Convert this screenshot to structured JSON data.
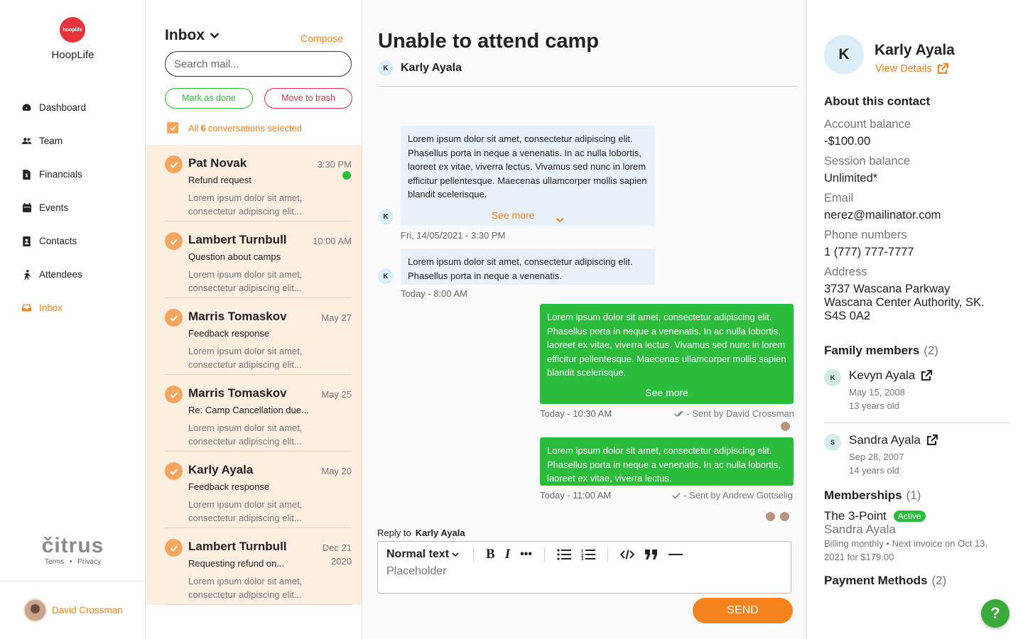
{
  "app": {
    "name": "HoopLife",
    "logo_text": "hooplife",
    "accent": "#f5841f",
    "success": "#2bbc3c",
    "danger": "#e33346"
  },
  "sidebar": {
    "items": [
      {
        "label": "Dashboard",
        "icon": "dashboard-icon"
      },
      {
        "label": "Team",
        "icon": "team-icon"
      },
      {
        "label": "Financials",
        "icon": "financials-icon"
      },
      {
        "label": "Events",
        "icon": "calendar-icon"
      },
      {
        "label": "Contacts",
        "icon": "contacts-icon"
      },
      {
        "label": "Attendees",
        "icon": "attendees-icon"
      },
      {
        "label": "Inbox",
        "icon": "inbox-icon",
        "active": true
      }
    ],
    "footer": {
      "brand": "čitrus",
      "terms": "Terms",
      "separator": "•",
      "privacy": "Privacy"
    },
    "user": {
      "name": "David Crossman"
    }
  },
  "inbox": {
    "title": "Inbox",
    "compose": "Compose",
    "search_placeholder": "Search mail...",
    "mark_done": "Mark as done",
    "move_trash": "Move to trash",
    "selection": {
      "prefix": "All",
      "count": "6",
      "suffix": "conversations selected"
    },
    "conversations": [
      {
        "name": "Pat Novak",
        "subject": "Refund request",
        "preview": "Lorem ipsum dolor sit amet, consectetur adipiscing elit...",
        "time": "3:30 PM",
        "unread": true
      },
      {
        "name": "Lambert Turnbull",
        "subject": "Question about camps",
        "preview": "Lorem ipsum dolor sit amet, consectetur adipiscing elit...",
        "time": "10:00 AM"
      },
      {
        "name": "Marris Tomaskov",
        "subject": "Feedback response",
        "preview": "Lorem ipsum dolor sit amet, consectetur adipiscing elit...",
        "time": "May 27"
      },
      {
        "name": "Marris Tomaskov",
        "subject": "Re: Camp Cancellation due...",
        "preview": "Lorem ipsum dolor sit amet, consectetur adipiscing elit...",
        "time": "May 25"
      },
      {
        "name": "Karly Ayala",
        "subject": "Feedback response",
        "preview": "Lorem ipsum dolor sit amet, consectetur adipiscing elit...",
        "time": "May 20"
      },
      {
        "name": "Lambert Turnbull",
        "subject": "Requesting refund on...",
        "preview": "Lorem ipsum dolor sit amet, consectetur adipiscing elit...",
        "time": "Dec 21 2020"
      }
    ]
  },
  "thread": {
    "title": "Unable to attend camp",
    "from_initial": "K",
    "from_name": "Karly Ayala",
    "messages": [
      {
        "text": "Lorem ipsum dolor sit amet, consectetur adipiscing elit. Phasellus porta in neque a venenatis. In ac nulla lobortis, laoreet ex vitae, viverra lectus. Vivamus sed nunc in lorem efficitur pellentesque. Maecenas ullamcorper mollis sapien blandit scelerisque.",
        "see_more": "See more",
        "meta": "Fri, 14/05/2021 - 3:30 PM",
        "initial": "K"
      },
      {
        "text": "Lorem ipsum dolor sit amet, consectetur adipiscing elit. Phasellus porta in neque a venenatis.",
        "meta": "Today - 8:00 AM",
        "initial": "K"
      },
      {
        "text": "Lorem ipsum dolor sit amet, consectetur adipiscing elit. Phasellus porta in neque a venenatis. In ac nulla lobortis, laoreet ex vitae, viverra lectus. Vivamus sed nunc in lorem efficitur pellentesque. Maecenas ullamcorper mollis sapien blandit scelerisque.",
        "see_more": "See more",
        "meta": "Today - 10:30 AM",
        "sent_by": "- Sent by David Crossman"
      },
      {
        "text": "Lorem ipsum dolor sit amet, consectetur adipiscing elit. Phasellus porta in neque a venenatis. In ac nulla lobortis, laoreet ex vitae, viverra lectus.",
        "meta": "Today - 11:00 AM",
        "sent_by": "- Sent by Andrew Gottselig"
      }
    ],
    "reply": {
      "label": "Reply to",
      "name": "Karly Ayala",
      "format": "Normal text",
      "placeholder": "Placeholder",
      "send": "SEND"
    }
  },
  "contact": {
    "initial": "K",
    "name": "Karly Ayala",
    "view_details": "View Details",
    "about_title": "About this contact",
    "account_balance_label": "Account balance",
    "account_balance": "-$100.00",
    "session_balance_label": "Session balance",
    "session_balance": "Unlimited*",
    "email_label": "Email",
    "email": "nerez@mailinator.com",
    "phone_label": "Phone numbers",
    "phone": "1 (777) 777-7777",
    "address_label": "Address",
    "address_line1": "3737 Wascana Parkway",
    "address_line2": "Wascana Center Authority, SK.",
    "address_line3": "S4S 0A2",
    "family_title": "Family members",
    "family_count": "(2)",
    "family": [
      {
        "initial": "K",
        "name": "Kevyn Ayala",
        "dob": "May 15, 2008",
        "age": "13 years old",
        "color": "#cfeadf"
      },
      {
        "initial": "S",
        "name": "Sandra Ayala",
        "dob": "Sep 28, 2007",
        "age": "14 years old",
        "color": "#d6ecec"
      }
    ],
    "memberships_title": "Memberships",
    "memberships_count": "(1)",
    "membership": {
      "name": "The 3-Point",
      "status": "Active",
      "holder": "Sandra Ayala",
      "billing": "Billing monthly • Next invoice on Oct 13, 2021 for $179.00"
    },
    "payment_title": "Payment Methods",
    "payment_count": "(2)",
    "help": "?"
  }
}
